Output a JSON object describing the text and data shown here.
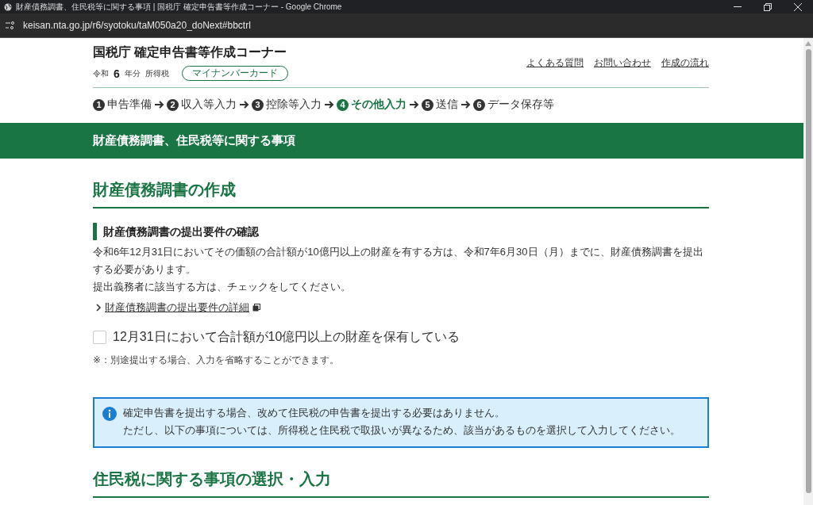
{
  "window": {
    "title": "財産債務調書、住民税等に関する事項 | 国税庁 確定申告書等作成コーナー - Google Chrome"
  },
  "address_bar": {
    "url": "keisan.nta.go.jp/r6/syotoku/taM050a20_doNext#bbctrl"
  },
  "header": {
    "site_title": "国税庁 確定申告書等作成コーナー",
    "era": "令和",
    "year": "6",
    "year_suffix": "年分",
    "tax_type": "所得税",
    "badge": "マイナンバーカード",
    "links": [
      "よくある質問",
      "お問い合わせ",
      "作成の流れ"
    ]
  },
  "steps": [
    {
      "number": "1",
      "label": "申告準備",
      "selected": false
    },
    {
      "number": "2",
      "label": "収入等入力",
      "selected": false
    },
    {
      "number": "3",
      "label": "控除等入力",
      "selected": false
    },
    {
      "number": "4",
      "label": "その他入力",
      "selected": true
    },
    {
      "number": "5",
      "label": "送信",
      "selected": false
    },
    {
      "number": "6",
      "label": "データ保存等",
      "selected": false
    }
  ],
  "page_banner": "財産債務調書、住民税等に関する事項",
  "section1": {
    "heading": "財産債務調書の作成",
    "subheading": "財産債務調書の提出要件の確認",
    "paragraphs": [
      "令和6年12月31日においてその価額の合計額が10億円以上の財産を有する方は、令和7年6月30日（月）までに、財産債務調書を提出する必要があります。",
      "提出義務者に該当する方は、チェックをしてください。"
    ],
    "link": "財産債務調書の提出要件の詳細",
    "checkbox": {
      "label": "12月31日において合計額が10億円以上の財産を保有している",
      "checked": false
    },
    "note": "※：別途提出する場合、入力を省略することができます。"
  },
  "info_box": {
    "lines": [
      "確定申告書を提出する場合、改めて住民税の申告書を提出する必要はありません。",
      "ただし、以下の事項については、所得税と住民税で取扱いが異なるため、該当があるものを選択して入力してください。"
    ]
  },
  "section2": {
    "heading": "住民税に関する事項の選択・入力"
  }
}
